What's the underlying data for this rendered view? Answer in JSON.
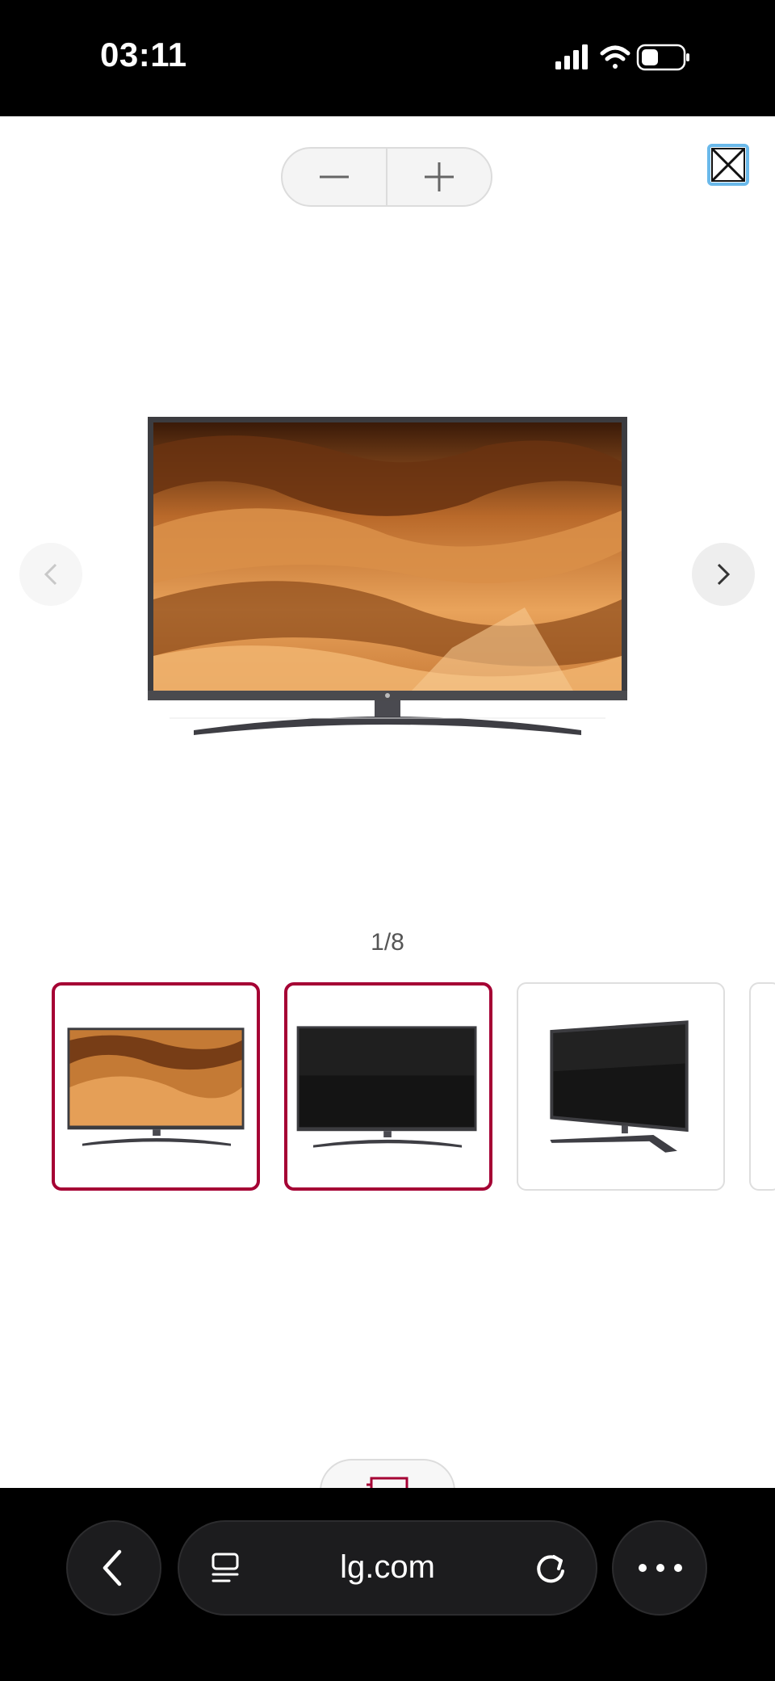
{
  "status_bar": {
    "time": "03:11",
    "icons": [
      "signal-icon",
      "wifi-icon",
      "battery-icon"
    ]
  },
  "viewer": {
    "zoom_out_icon": "minus-icon",
    "zoom_in_icon": "plus-icon",
    "close_icon": "close-icon",
    "prev_icon": "chevron-left-icon",
    "next_icon": "chevron-right-icon",
    "counter": "1/8",
    "thumbnails": [
      {
        "description": "tv-front-desert",
        "selected": true
      },
      {
        "description": "tv-front-black",
        "selected": true
      },
      {
        "description": "tv-angled-black",
        "selected": false
      },
      {
        "description": "tv-partial",
        "selected": false
      }
    ]
  },
  "browser": {
    "url": "lg.com",
    "back_icon": "chevron-left-icon",
    "tabs_icon": "page-menu-icon",
    "reload_icon": "reload-icon",
    "more_icon": "more-icon"
  },
  "colors": {
    "selected_border": "#a50034",
    "close_border": "#6ab9ea"
  }
}
